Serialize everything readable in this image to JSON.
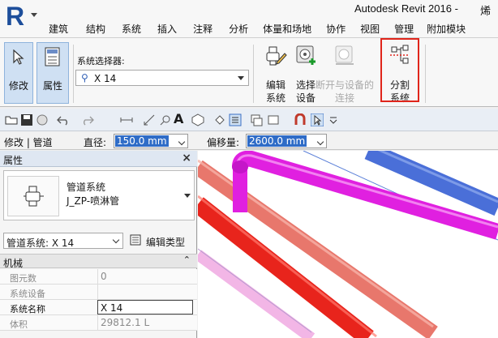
{
  "app": {
    "title": "Autodesk Revit 2016 -",
    "title_truncated": "烯"
  },
  "tabs": [
    "建筑",
    "结构",
    "系统",
    "插入",
    "注释",
    "分析",
    "体量和场地",
    "协作",
    "视图",
    "管理",
    "附加模块"
  ],
  "ribbon": {
    "modify_label": "修改",
    "properties_label": "属性",
    "system_selector_label": "系统选择器:",
    "system_selector_value": "X 14",
    "tools": [
      {
        "line1": "编辑",
        "line2": "系统",
        "icon": "edit-system-icon",
        "enabled": true
      },
      {
        "line1": "选择",
        "line2": "设备",
        "icon": "select-equipment-icon",
        "enabled": true
      },
      {
        "line1": "断开与设备的",
        "line2": "连接",
        "icon": "disconnect-equipment-icon",
        "enabled": false
      },
      {
        "line1": "分割",
        "line2": "系统",
        "icon": "divide-system-icon",
        "enabled": true
      }
    ]
  },
  "options_bar": {
    "context": "修改 | 管道",
    "diameter_label": "直径:",
    "diameter_value": "150.0 mm",
    "offset_label": "偏移量:",
    "offset_value": "2600.0 mm"
  },
  "properties": {
    "header": "属性",
    "close": "×",
    "family": "管道系统",
    "type": "J_ZP-喷淋管",
    "instance_selector": "管道系统: X 14",
    "edit_type": "编辑类型",
    "group": "机械",
    "group_toggle": "⌃",
    "rows": [
      {
        "key": "图元数",
        "value": "0"
      },
      {
        "key": "系统设备",
        "value": ""
      },
      {
        "key": "系统名称",
        "value": "X 14"
      },
      {
        "key": "体积",
        "value": "29812.1 L"
      }
    ]
  },
  "colors": {
    "selection_highlight": "#e0251b",
    "selected_input": "#2f6cc7",
    "pipe_magenta": "#e020e0",
    "pipe_red": "#e8241c",
    "pipe_salmon": "#e8776c",
    "pipe_blue": "#4a6fd8",
    "pipe_pink": "#f2b6e6"
  }
}
